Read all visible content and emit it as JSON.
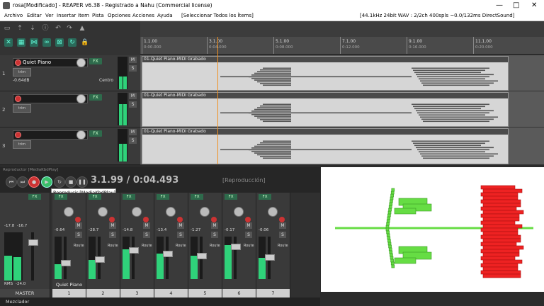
{
  "window": {
    "title": "rosa[Modificado] - REAPER v6.38 - Registrado a Nahu (Commercial license)",
    "minimize": "—",
    "maximize": "□",
    "close": "✕"
  },
  "menubar": {
    "items": [
      "Archivo",
      "Editar",
      "Ver",
      "Insertar",
      "Item",
      "Pista",
      "Opciones",
      "Acciones",
      "Ayuda"
    ],
    "action_hint": "[Seleccionar Todos los Ítems]",
    "status": "[44.1kHz 24bit WAV : 2/2ch 400spls ~0.0/132ms DirectSound]"
  },
  "ruler": {
    "ticks": [
      {
        "bar": "1.1.00",
        "time": "0:00.000"
      },
      {
        "bar": "3.1.00",
        "time": "0:04.000"
      },
      {
        "bar": "5.1.00",
        "time": "0:08.000"
      },
      {
        "bar": "7.1.00",
        "time": "0:12.000"
      },
      {
        "bar": "9.1.00",
        "time": "0:16.000"
      },
      {
        "bar": "11.1.00",
        "time": "0:20.000"
      }
    ]
  },
  "tracks": [
    {
      "number": "1",
      "name": "Quiet Piano",
      "volume": "-0.64dB",
      "pan": "Centro",
      "item": "01-Quiet Piano-MIDI Grabado",
      "meter": 0.4
    },
    {
      "number": "2",
      "name": "",
      "volume": "",
      "pan": "",
      "item": "01-Quiet Piano-MIDI Grabado",
      "meter": 0.65
    },
    {
      "number": "3",
      "name": "",
      "volume": "",
      "pan": "",
      "item": "01-Quiet Piano-MIDI Grabado",
      "meter": 0.55
    }
  ],
  "track_buttons": {
    "mute": "M",
    "solo": "S",
    "fx": "FX",
    "env": "trim"
  },
  "transport": {
    "panel_label": "Reproductor [MediaKbdPlay]",
    "position": "3.1.99 / 0:04.493",
    "state": "[Reproducción]",
    "tooltip": "Reproducir [MediaKbdPlay]"
  },
  "mixer": {
    "master_label": "MASTER",
    "master_db_left": "-17.8",
    "master_db_right": "-16.7",
    "master_rms_label": "RMS",
    "master_rms": "-24.0",
    "route_label": "Route",
    "strips": [
      {
        "label": "Quiet Piano",
        "number": "1",
        "db": "-0.64",
        "meter": 0.35
      },
      {
        "label": "",
        "number": "2",
        "db": "-28.7",
        "meter": 0.45
      },
      {
        "label": "",
        "number": "3",
        "db": "-14.8",
        "meter": 0.7
      },
      {
        "label": "",
        "number": "4",
        "db": "-13.4",
        "meter": 0.6
      },
      {
        "label": "",
        "number": "5",
        "db": "-1.27",
        "meter": 0.55
      },
      {
        "label": "",
        "number": "6",
        "db": "-0.17",
        "meter": 0.8
      },
      {
        "label": "",
        "number": "7",
        "db": "-0.06",
        "meter": 0.5
      }
    ],
    "docker_tab": "Mezclador"
  },
  "colors": {
    "accent_green": "#2fd27a",
    "record_red": "#cc3333",
    "cursor_orange": "#f09020",
    "viz_green": "#66dd44",
    "viz_red": "#ee2222"
  }
}
